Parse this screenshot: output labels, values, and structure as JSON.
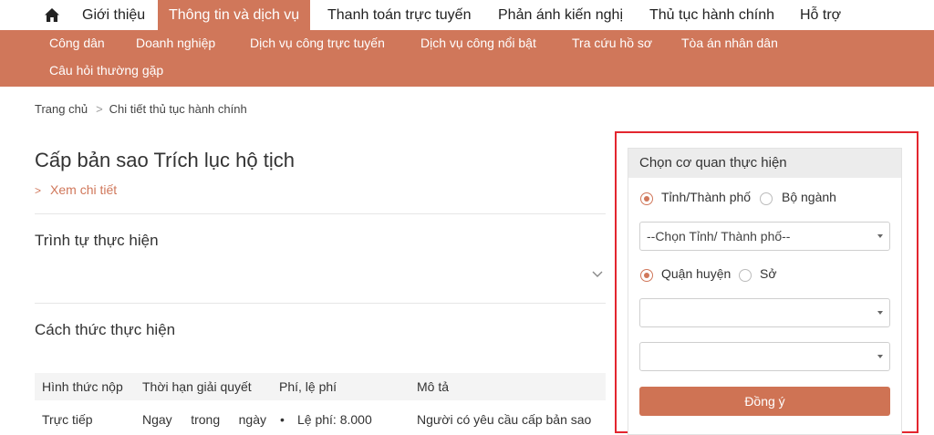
{
  "topnav": {
    "items": [
      {
        "label": "Giới thiệu"
      },
      {
        "label": "Thông tin và dịch vụ",
        "active": true
      },
      {
        "label": "Thanh toán trực tuyến"
      },
      {
        "label": "Phản ánh kiến nghị"
      },
      {
        "label": "Thủ tục hành chính"
      },
      {
        "label": "Hỗ trợ"
      }
    ]
  },
  "subnav": {
    "items": [
      {
        "label": "Công dân"
      },
      {
        "label": "Doanh nghiệp"
      },
      {
        "label": "Dịch vụ công trực tuyến"
      },
      {
        "label": "Dịch vụ công nổi bật"
      },
      {
        "label": "Tra cứu hồ sơ"
      },
      {
        "label": "Tòa án nhân dân"
      },
      {
        "label": "Câu hỏi thường gặp"
      }
    ]
  },
  "breadcrumb": {
    "home": "Trang chủ",
    "separator": ">",
    "current": "Chi tiết thủ tục hành chính"
  },
  "main": {
    "title": "Cấp bản sao Trích lục hộ tịch",
    "detail_chevron": ">",
    "detail_link": "Xem chi tiết",
    "section_sequence": "Trình tự thực hiện",
    "section_method": "Cách thức thực hiện",
    "table": {
      "headers": [
        "Hình thức nộp",
        "Thời hạn giải quyết",
        "Phí, lệ phí",
        "Mô tả"
      ],
      "rows": [
        {
          "form": "Trực tiếp",
          "duration": "Ngay trong ngày",
          "fee_bullet": "•",
          "fee": "Lệ phí: 8.000",
          "description": "Người có yêu cầu cấp bản sao"
        }
      ]
    }
  },
  "panel": {
    "title": "Chọn cơ quan thực hiện",
    "level1_options": [
      {
        "label": "Tỉnh/Thành phố",
        "checked": true
      },
      {
        "label": "Bộ ngành",
        "checked": false
      }
    ],
    "province_select": "--Chọn Tỉnh/ Thành phố--",
    "level2_options": [
      {
        "label": "Quận huyện",
        "checked": true
      },
      {
        "label": "Sở",
        "checked": false
      }
    ],
    "district_select": "",
    "unit_select": "",
    "submit_label": "Đồng ý"
  },
  "colors": {
    "accent": "#d0775a",
    "highlight_frame": "#e3262f"
  }
}
